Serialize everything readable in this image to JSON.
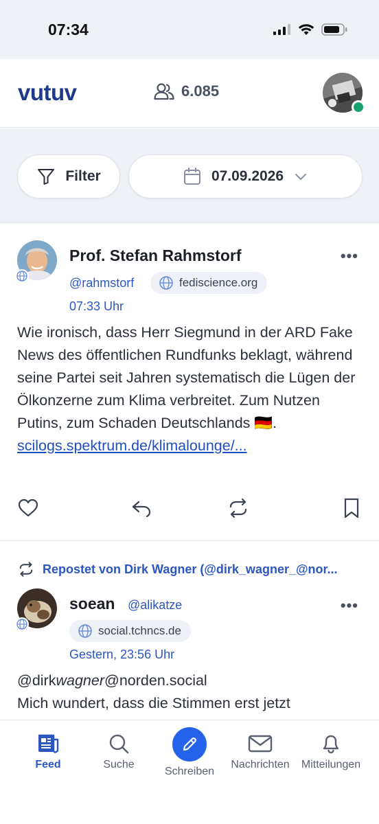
{
  "status_bar": {
    "time": "07:34"
  },
  "header": {
    "logo": "vutuv",
    "member_count": "6.085"
  },
  "filters": {
    "filter_label": "Filter",
    "date_label": "07.09.2026"
  },
  "posts": [
    {
      "author": "Prof. Stefan Rahmstorf",
      "handle": "@rahmstorf",
      "instance": "fediscience.org",
      "time": "07:33 Uhr",
      "text": "Wie ironisch, dass Herr Siegmund in der ARD Fake News des öffentlichen Rundfunks be­klagt, während seine Partei seit Jahren syste­matisch die Lügen der Ölkonzerne zum Klima verbreitet. Zum Nutzen Putins, zum Schaden Deutschlands 🇩🇪.",
      "link": "scilogs.spektrum.de/klimalounge/..."
    },
    {
      "repost_line": "Repostet von Dirk Wagner (@dirk_wagner_@nor...",
      "author": "soean",
      "handle": "@alikatze",
      "instance": "social.tchncs.de",
      "time": "Gestern, 23:56 Uhr",
      "text_mention_start": "@dirk",
      "text_mention_italic": "wagner",
      "text_mention_end": "@norden.social",
      "text_line2": "Mich wundert, dass die Stimmen erst jetzt"
    }
  ],
  "tabbar": {
    "items": [
      {
        "label": "Feed"
      },
      {
        "label": "Suche"
      },
      {
        "label": "Schreiben"
      },
      {
        "label": "Nachrichten"
      },
      {
        "label": "Mitteilungen"
      }
    ]
  },
  "colors": {
    "accent": "#2563eb",
    "link": "#2c56c0",
    "logo": "#1e3a8a",
    "online": "#16a36e"
  }
}
